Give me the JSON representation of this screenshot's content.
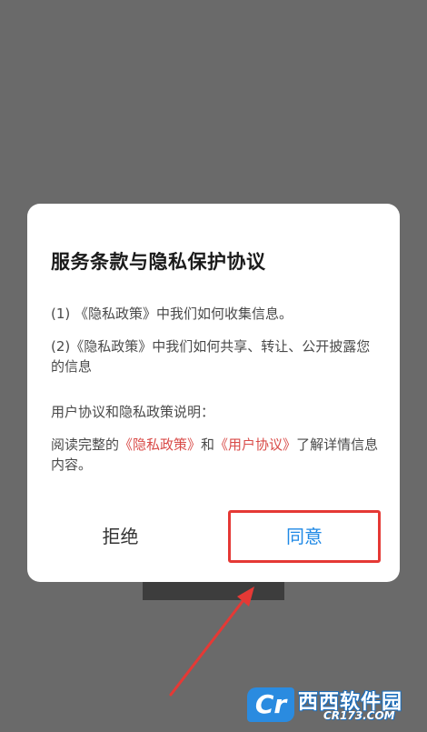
{
  "dialog": {
    "title": "服务条款与隐私保护协议",
    "item1": "(1) 《隐私政策》中我们如何收集信息。",
    "item2": "(2)《隐私政策》中我们如何共享、转让、公开披露您的信息",
    "section_title": "用户协议和隐私政策说明：",
    "read_prefix": "阅读完整的",
    "privacy_link": "《隐私政策》",
    "and_text": "和",
    "user_link": "《用户协议》",
    "read_suffix": "了解详情信息内容。",
    "reject_label": "拒绝",
    "agree_label": "同意"
  },
  "watermark": {
    "badge": "Cr",
    "name": "西西软件园",
    "site": "CR173.COM"
  },
  "colors": {
    "link": "#d94b48",
    "agree": "#1e88e5",
    "highlight": "#e53935"
  }
}
